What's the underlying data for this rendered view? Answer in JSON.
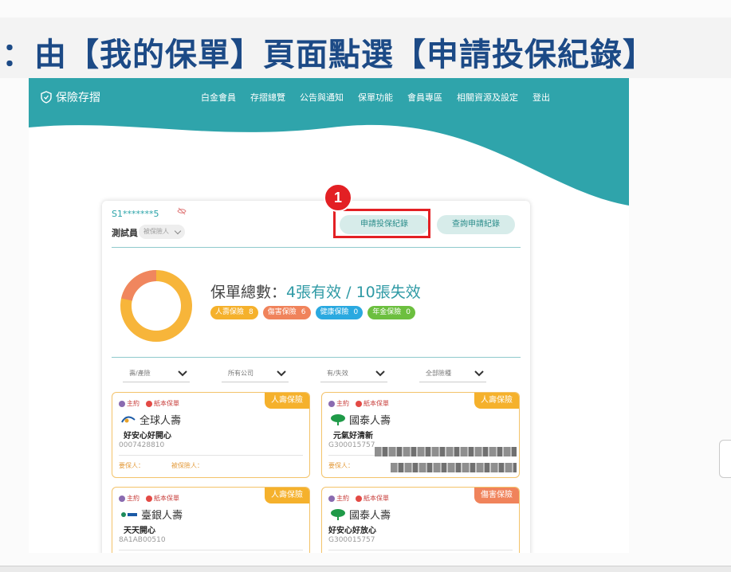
{
  "heading": "：由【我的保單】頁面點選【申請投保紀錄】",
  "nav": {
    "logo_label": "保險存摺",
    "menu": [
      "白金會員",
      "存摺總覽",
      "公告與通知",
      "保單功能",
      "會員專區",
      "相關資源及設定",
      "登出"
    ]
  },
  "user": {
    "id": "S1*******5",
    "name": "測試員",
    "role": "被保險人"
  },
  "buttons": {
    "apply_records": "申請投保紀錄",
    "query_records": "查詢申請紀錄"
  },
  "step_number": "1",
  "summary": {
    "label": "保單總數：",
    "counts": "4張有效 / 10張失效"
  },
  "chips": [
    {
      "label": "人壽保險",
      "count": "8",
      "color": "#f5b12c"
    },
    {
      "label": "傷害保險",
      "count": "6",
      "color": "#f0835b"
    },
    {
      "label": "健康保險",
      "count": "0",
      "color": "#2aa9e0"
    },
    {
      "label": "年金保險",
      "count": "0",
      "color": "#6cbf3f"
    }
  ],
  "donut": {
    "primary_color": "#f7b53a",
    "secondary_color": "#f0865e"
  },
  "filters": [
    "壽/產險",
    "所有公司",
    "有/失效",
    "全部險種"
  ],
  "cards": [
    {
      "tag": "人壽保險",
      "tag_color": "#f5b12c",
      "badge_main": "主約",
      "badge_paper": "紙本保單",
      "company": "全球人壽",
      "product": "好安心好開心",
      "number": "0007428810",
      "footer_applicant": "要保人：",
      "footer_insured": "被保險人："
    },
    {
      "tag": "人壽保險",
      "tag_color": "#f5b12c",
      "badge_main": "主約",
      "badge_paper": "紙本保單",
      "company": "國泰人壽",
      "product": "元氣好清新",
      "number": "G300015757",
      "footer_applicant": "要保人："
    },
    {
      "tag": "人壽保險",
      "tag_color": "#f5b12c",
      "badge_main": "主約",
      "badge_paper": "紙本保單",
      "company": "臺銀人壽",
      "product": "天天開心",
      "number": "8A1AB00510"
    },
    {
      "tag": "傷害保險",
      "tag_color": "#f0835b",
      "badge_main": "主約",
      "badge_paper": "紙本保單",
      "company": "國泰人壽",
      "product": "好安心好放心",
      "number": "G300015757"
    }
  ]
}
